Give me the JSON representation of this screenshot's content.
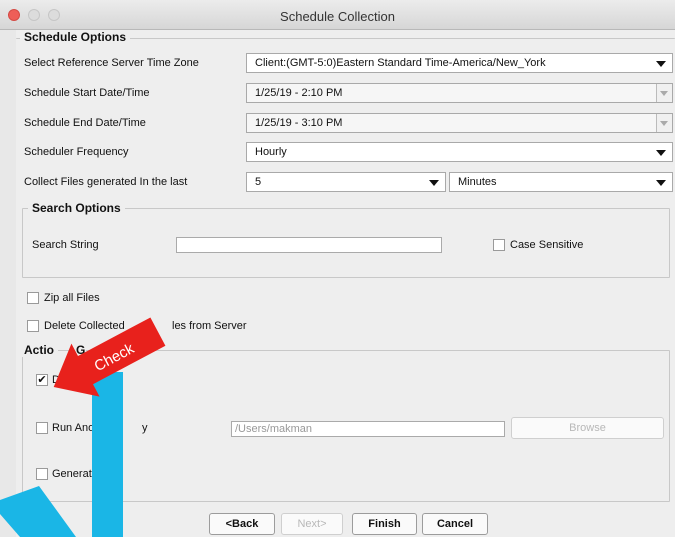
{
  "window": {
    "title": "Schedule Collection"
  },
  "schedule_options": {
    "legend": "Schedule Options",
    "timezone_label": "Select Reference Server Time Zone",
    "timezone_value": "Client:(GMT-5:0)Eastern Standard Time-America/New_York",
    "start_label": "Schedule Start Date/Time",
    "start_value": "1/25/19 - 2:10 PM",
    "end_label": "Schedule End Date/Time",
    "end_value": "1/25/19 - 3:10 PM",
    "frequency_label": "Scheduler Frequency",
    "frequency_value": "Hourly",
    "collect_label": "Collect Files generated In the last",
    "collect_amount": "5",
    "collect_unit": "Minutes"
  },
  "search_options": {
    "legend": "Search Options",
    "search_label": "Search String",
    "search_value": "",
    "case_label": "Case Sensitive"
  },
  "zip_label": "Zip all Files",
  "delete_label_left": "Delete Collected",
  "delete_label_right": "les from Server",
  "action_options": {
    "legend": "Actio",
    "legend_tail": "G",
    "download_label": "Dow",
    "download_label_tail": "loa",
    "run_label": "Run Anot",
    "run_label_tail": "y",
    "path_value": "/Users/makman",
    "browse_label": "Browse",
    "generate_label": "Generate"
  },
  "buttons": {
    "back": "<Back",
    "next": "Next>",
    "finish": "Finish",
    "cancel": "Cancel"
  },
  "annotation": {
    "callout_text": "Check",
    "callout_color": "#e8211c",
    "arrow_color": "#1ab6e6"
  }
}
